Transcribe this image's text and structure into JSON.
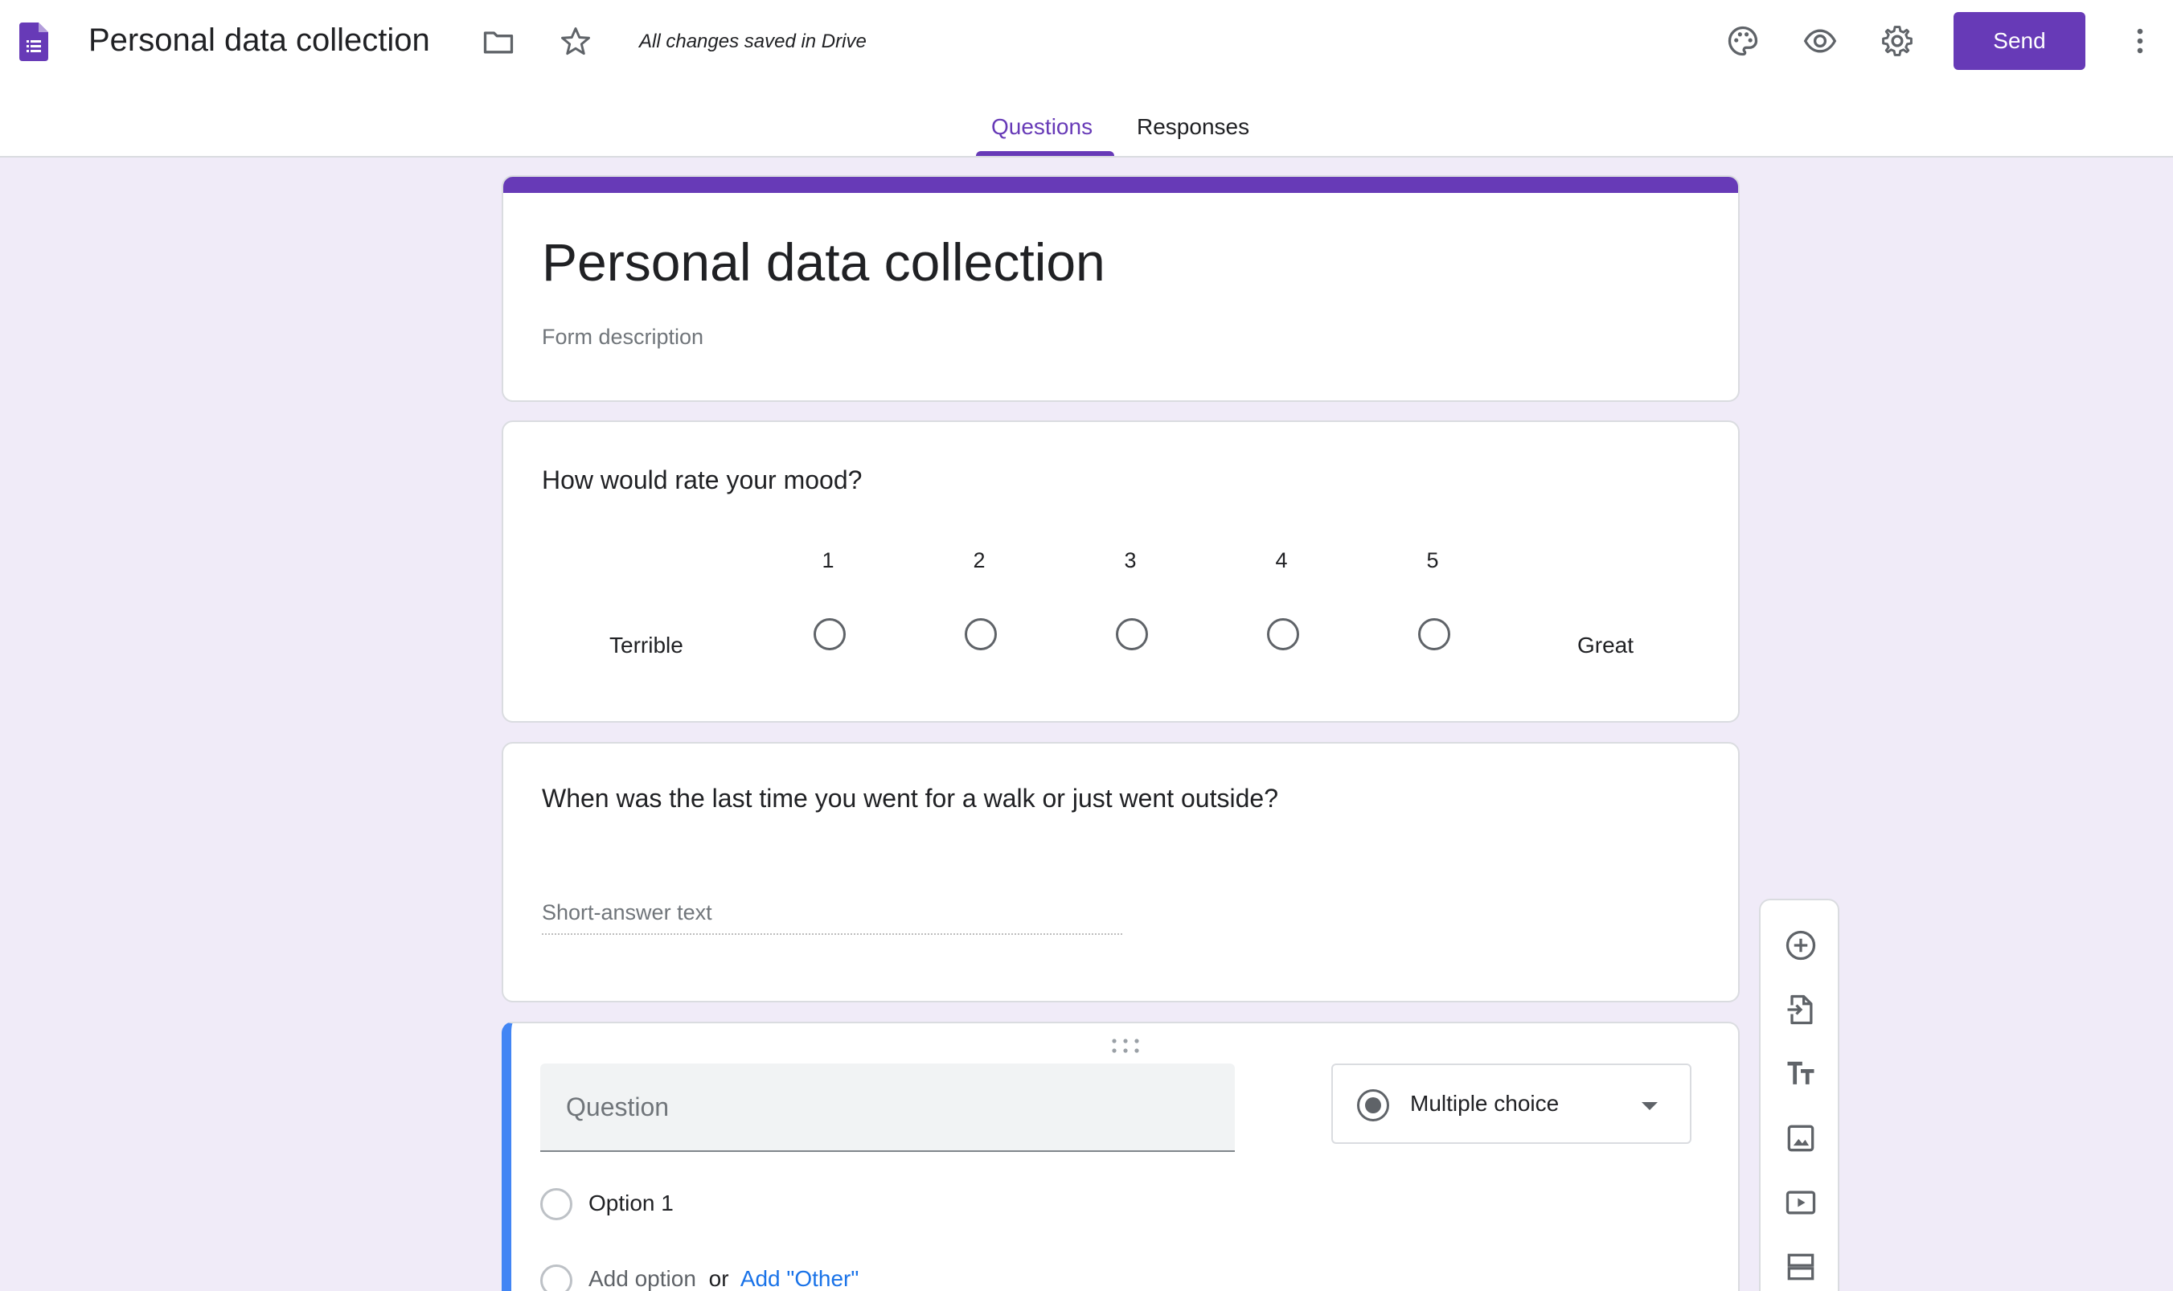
{
  "header": {
    "app_title": "Personal data collection",
    "saved_status": "All changes saved in Drive",
    "send_label": "Send",
    "tabs": [
      {
        "label": "Questions",
        "active": true
      },
      {
        "label": "Responses",
        "active": false
      }
    ],
    "icons": [
      "forms-doc-icon",
      "folder-icon",
      "star-icon",
      "palette-icon",
      "eye-icon",
      "gear-icon",
      "more-vert-icon"
    ],
    "accent_color": "#673ab7"
  },
  "form": {
    "title": "Personal data collection",
    "description_placeholder": "Form description",
    "questions": [
      {
        "title": "How would rate your mood?",
        "type": "linear-scale",
        "scale": [
          "1",
          "2",
          "3",
          "4",
          "5"
        ],
        "low_label": "Terrible",
        "high_label": "Great"
      },
      {
        "title": "When was the last time you went for a walk or just went outside?",
        "type": "short-answer",
        "placeholder": "Short-answer text"
      },
      {
        "type": "multiple-choice",
        "question_placeholder": "Question",
        "type_label": "Multiple choice",
        "options": [
          "Option 1"
        ],
        "add_option": "Add option",
        "or_text": "or",
        "add_other": "Add \"Other\""
      }
    ]
  },
  "toolbar": {
    "tools": [
      "add-question-icon",
      "import-questions-icon",
      "add-title-icon",
      "add-image-icon",
      "add-video-icon",
      "add-section-icon"
    ]
  }
}
